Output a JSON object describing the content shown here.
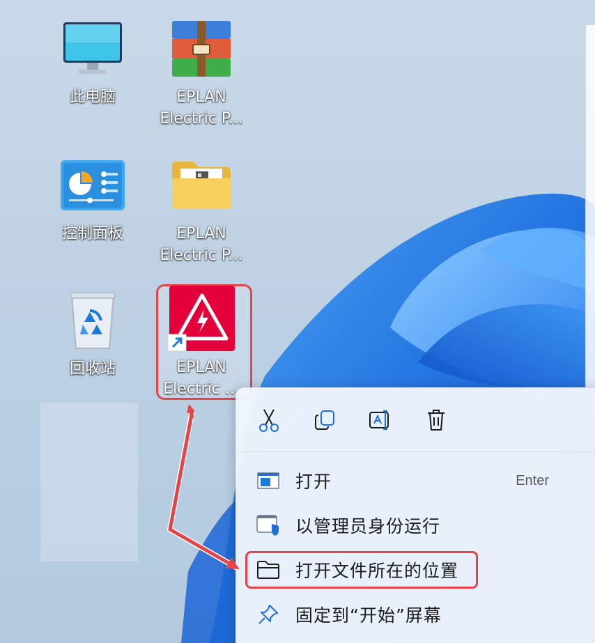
{
  "desktop": {
    "icons": [
      {
        "label": "此电脑",
        "icon": "this-pc-icon"
      },
      {
        "label": "EPLAN\nElectric P...",
        "icon": "winrar-archive-icon"
      },
      {
        "label": "控制面板",
        "icon": "control-panel-icon"
      },
      {
        "label": "EPLAN\nElectric P...",
        "icon": "folder-icon"
      },
      {
        "label": "回收站",
        "icon": "recycle-bin-icon"
      },
      {
        "label": "EPLAN\nElectric ...",
        "icon": "eplan-shortcut-icon"
      }
    ]
  },
  "context_menu": {
    "toolbar": [
      {
        "name": "cut",
        "icon": "scissors-icon"
      },
      {
        "name": "copy",
        "icon": "copy-icon"
      },
      {
        "name": "rename",
        "icon": "rename-icon"
      },
      {
        "name": "delete",
        "icon": "trash-icon"
      }
    ],
    "items": [
      {
        "label": "打开",
        "shortcut": "Enter",
        "icon": "open-app-icon"
      },
      {
        "label": "以管理员身份运行",
        "icon": "run-as-admin-icon"
      },
      {
        "label": "打开文件所在的位置",
        "icon": "folder-outline-icon"
      },
      {
        "label": "固定到“开始”屏幕",
        "icon": "pin-icon"
      }
    ]
  },
  "colors": {
    "highlight": "#e5444a",
    "eplan_red": "#e4003b",
    "menu_bg": "#f0f6fc"
  }
}
